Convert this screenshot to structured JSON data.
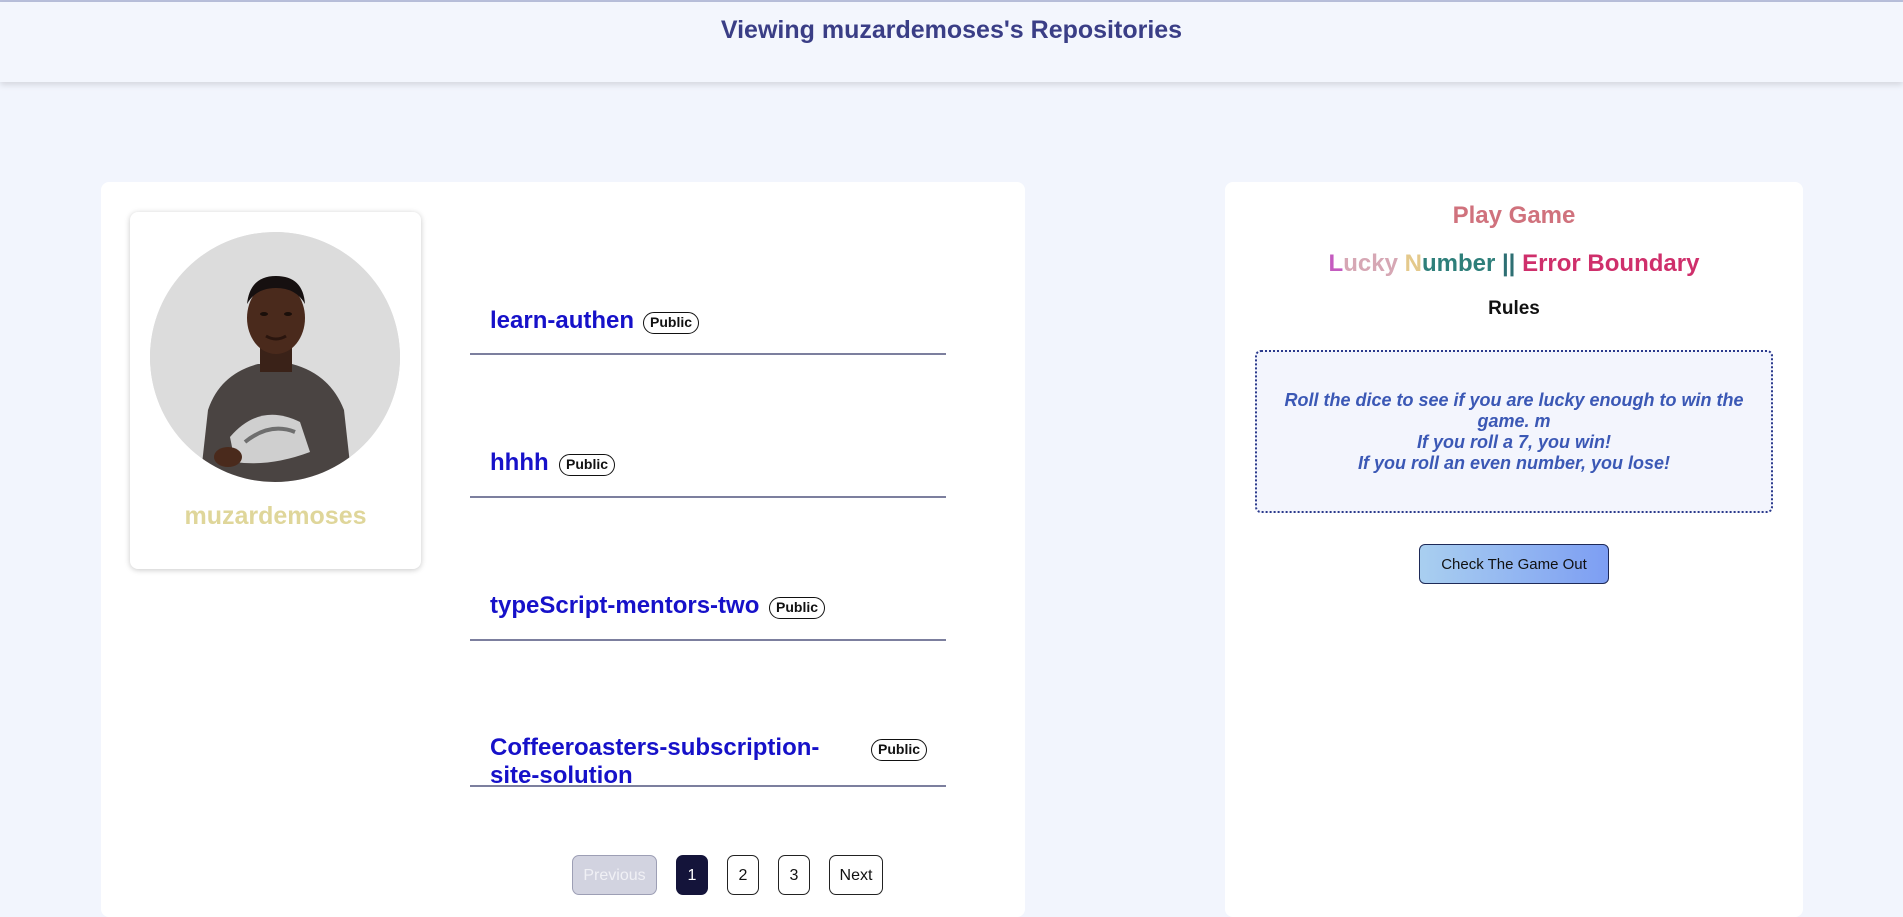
{
  "header": {
    "title": "Viewing muzardemoses's Repositories"
  },
  "profile": {
    "username": "muzardemoses",
    "avatar_alt": "avatar"
  },
  "repos": [
    {
      "name_line1": "learn-authen",
      "name_line2": "",
      "visibility": "Public"
    },
    {
      "name_line1": "hhhh",
      "name_line2": "",
      "visibility": "Public"
    },
    {
      "name_line1": "typeScript-mentors-two",
      "name_line2": "",
      "visibility": "Public"
    },
    {
      "name_line1": "Coffeeroasters-subscription-",
      "name_line2": "site-solution",
      "visibility": "Public"
    }
  ],
  "pagination": {
    "previous": "Previous",
    "pages": [
      "1",
      "2",
      "3"
    ],
    "current": "1",
    "next": "Next"
  },
  "game": {
    "play_title": "Play Game",
    "title_parts": {
      "lucky_l": "L",
      "lucky_rest": "ucky",
      "space1": " ",
      "number_n": "N",
      "number_rest": "umber",
      "separator": " || ",
      "error_boundary": "Error Boundary"
    },
    "rules_title": "Rules",
    "rules_lines": [
      "Roll the dice to see if you are lucky enough to win the game. m",
      "If you roll a 7, you win!",
      "If you roll an even number, you lose!"
    ],
    "cta_label": "Check The Game Out"
  },
  "colors": {
    "header_text": "#3a3e86",
    "repo_link": "#1611c9",
    "username": "#dfd69a",
    "play_title": "#d0727d",
    "rules_text": "#3b58b5",
    "error_boundary": "#cf2f6b"
  }
}
